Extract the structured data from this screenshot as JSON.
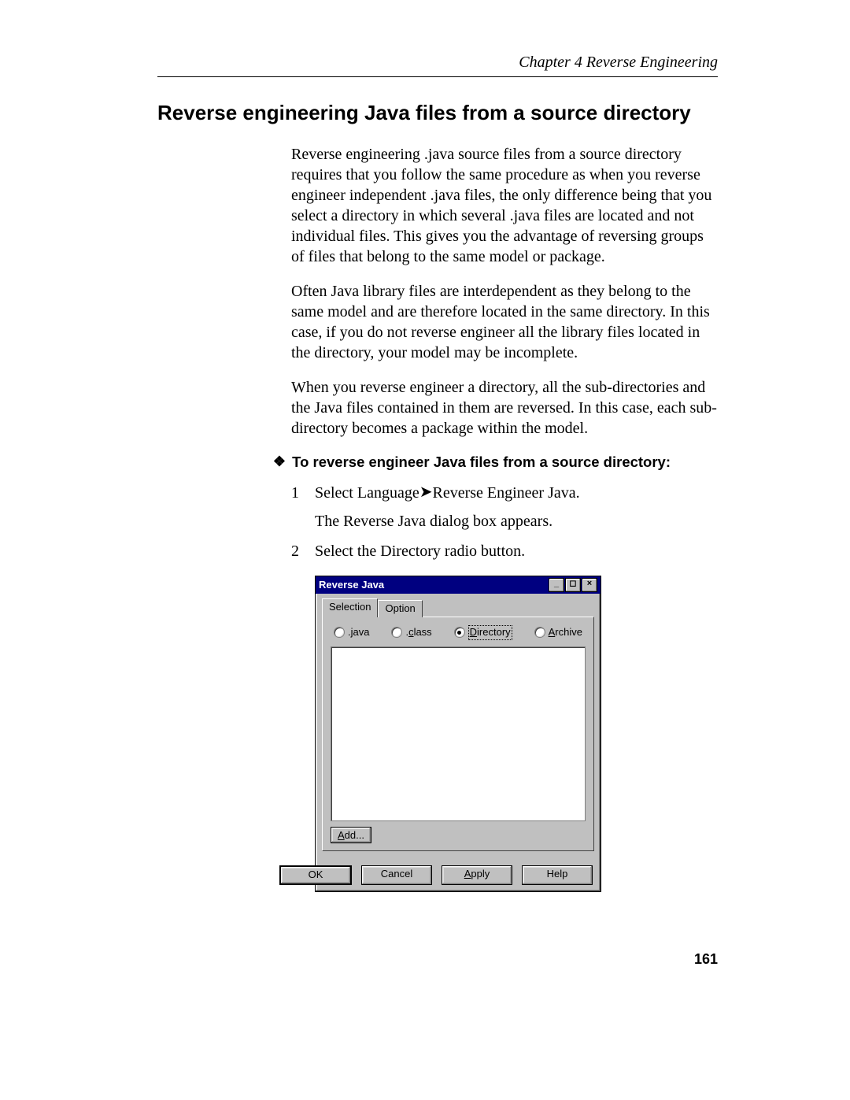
{
  "header": {
    "chapter_label": "Chapter 4  Reverse Engineering"
  },
  "section": {
    "title": "Reverse engineering Java files from a source directory"
  },
  "paragraphs": {
    "p1": "Reverse engineering .java source files from a source directory requires that you follow the same procedure as when you reverse engineer independent .java files, the only difference being that you select a directory in which several .java files are located and not individual files. This gives you the advantage of reversing groups of files that belong to the same model or package.",
    "p2": "Often Java library files are interdependent as they belong to the same model and are therefore located in the same directory. In this case, if you do not reverse engineer all the library files located in the directory, your model may be incomplete.",
    "p3": "When you reverse engineer a directory, all the sub-directories and the Java files contained in them are reversed. In this case, each sub-directory becomes a package within the model."
  },
  "procedure": {
    "heading": "To reverse engineer Java files from a source directory:",
    "steps": {
      "s1_num": "1",
      "s1_line1a": "Select Language",
      "s1_line1b": "Reverse Engineer Java.",
      "s1_line2": "The Reverse Java dialog box appears.",
      "s2_num": "2",
      "s2_line1": "Select the Directory radio button."
    }
  },
  "dialog": {
    "title": "Reverse Java",
    "tabs": {
      "selection": "Selection",
      "option": "Option"
    },
    "radios": {
      "java_u": "j",
      "java_rest": "ava",
      "class_u": "c",
      "class_rest": "lass",
      "dir_u": "D",
      "dir_rest": "irectory",
      "arc_u": "A",
      "arc_rest": "rchive"
    },
    "buttons": {
      "add_u": "A",
      "add_rest": "dd...",
      "ok": "OK",
      "cancel": "Cancel",
      "apply_u": "A",
      "apply_rest": "pply",
      "help": "Help"
    }
  },
  "page_number": "161"
}
